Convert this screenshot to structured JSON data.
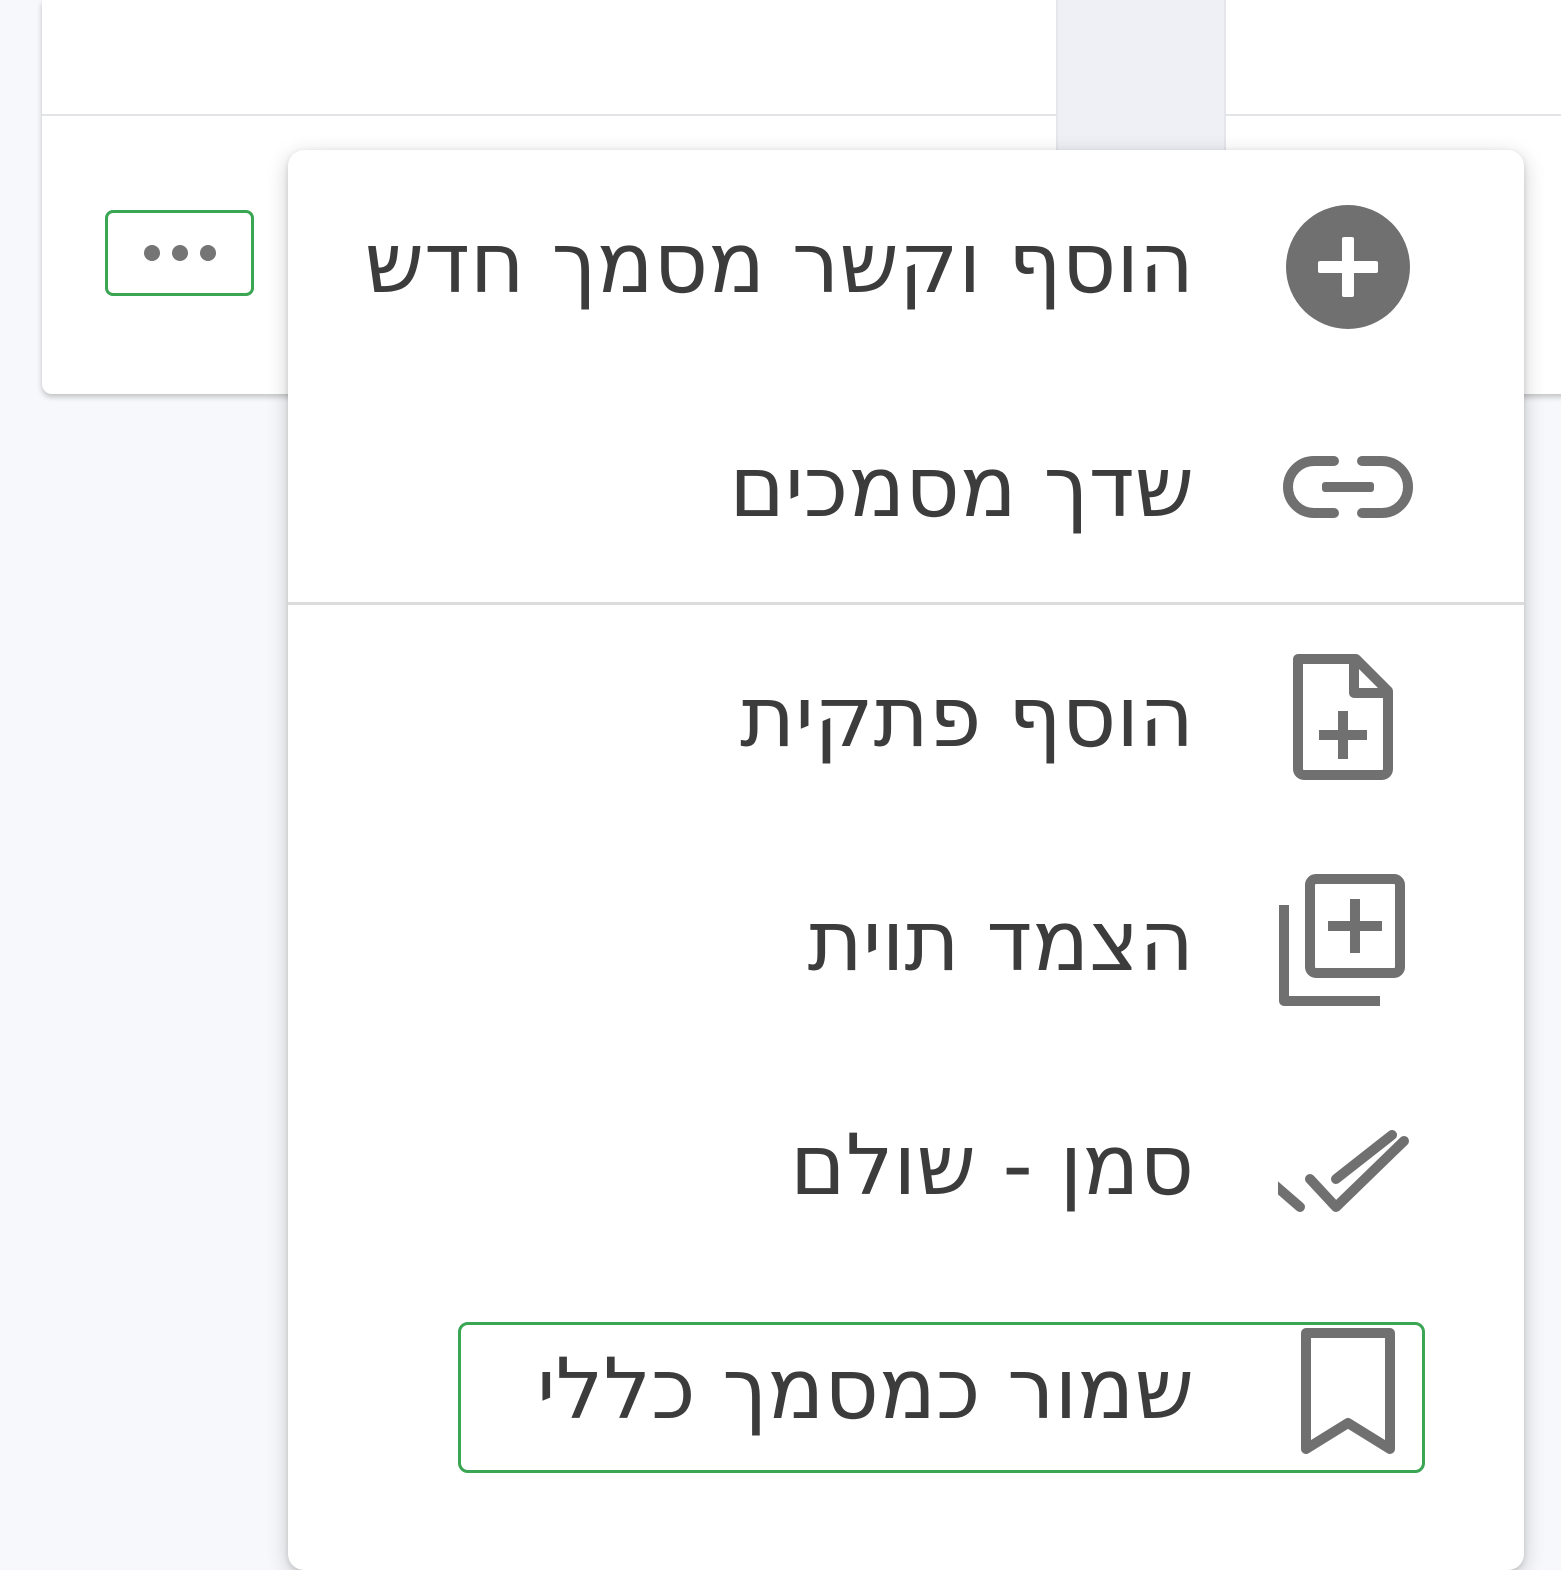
{
  "menu": {
    "items": [
      {
        "label": "הוסף וקשר מסמך חדש",
        "icon": "add-circle-icon"
      },
      {
        "label": "שדך מסמכים",
        "icon": "link-icon"
      },
      {
        "label": "הוסף פתקית",
        "icon": "note-add-icon"
      },
      {
        "label": "הצמד תוית",
        "icon": "library-add-icon"
      },
      {
        "label": "סמן - שולם",
        "icon": "done-all-icon"
      },
      {
        "label": "שמור כמסמך כללי",
        "icon": "bookmark-icon"
      }
    ]
  },
  "colors": {
    "icon": "#707070",
    "text": "#3c3c3c",
    "focus_outline": "#3aa552"
  }
}
